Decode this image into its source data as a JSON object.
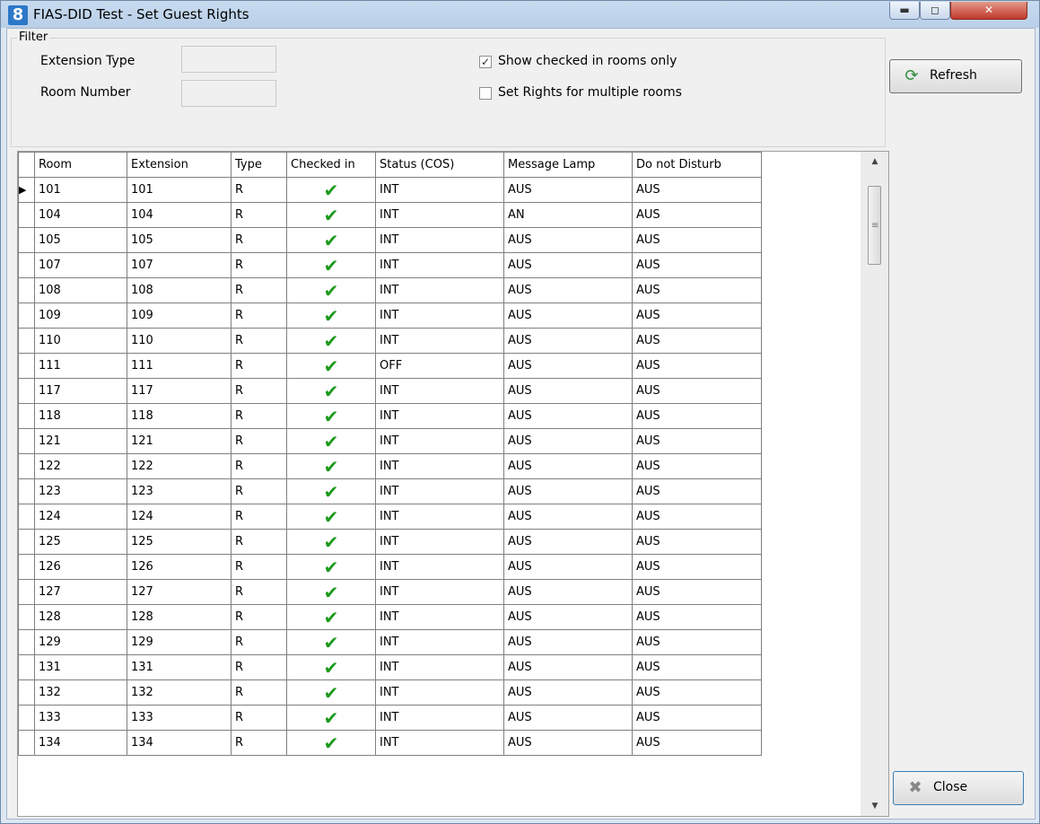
{
  "window": {
    "icon_text": "8",
    "title": "FIAS-DID Test -  Set Guest Rights",
    "min_symbol": "▬",
    "max_symbol": "◻",
    "close_symbol": "✕"
  },
  "filter": {
    "legend": "Filter",
    "extension_type_label": "Extension Type",
    "room_number_label": "Room Number",
    "extension_type_value": "",
    "room_number_value": "",
    "show_checked_in_label": "Show checked in rooms only",
    "show_checked_in_checked": true,
    "multiple_rooms_label": "Set Rights for multiple rooms",
    "multiple_rooms_checked": false
  },
  "buttons": {
    "refresh_label": "Refresh",
    "refresh_icon": "refresh-icon",
    "close_label": "Close",
    "close_icon": "close-x-icon"
  },
  "grid": {
    "columns": [
      "Room",
      "Extension",
      "Type",
      "Checked in",
      "Status (COS)",
      "Message Lamp",
      "Do not Disturb"
    ],
    "current_row_indicator": "▶",
    "checkmark": "✔",
    "rows": [
      {
        "room": "101",
        "extension": "101",
        "type": "R",
        "checked_in": true,
        "status": "INT",
        "lamp": "AUS",
        "dnd": "AUS"
      },
      {
        "room": "104",
        "extension": "104",
        "type": "R",
        "checked_in": true,
        "status": "INT",
        "lamp": "AN",
        "dnd": "AUS"
      },
      {
        "room": "105",
        "extension": "105",
        "type": "R",
        "checked_in": true,
        "status": "INT",
        "lamp": "AUS",
        "dnd": "AUS"
      },
      {
        "room": "107",
        "extension": "107",
        "type": "R",
        "checked_in": true,
        "status": "INT",
        "lamp": "AUS",
        "dnd": "AUS"
      },
      {
        "room": "108",
        "extension": "108",
        "type": "R",
        "checked_in": true,
        "status": "INT",
        "lamp": "AUS",
        "dnd": "AUS"
      },
      {
        "room": "109",
        "extension": "109",
        "type": "R",
        "checked_in": true,
        "status": "INT",
        "lamp": "AUS",
        "dnd": "AUS"
      },
      {
        "room": "110",
        "extension": "110",
        "type": "R",
        "checked_in": true,
        "status": "INT",
        "lamp": "AUS",
        "dnd": "AUS"
      },
      {
        "room": "111",
        "extension": "111",
        "type": "R",
        "checked_in": true,
        "status": "OFF",
        "lamp": "AUS",
        "dnd": "AUS"
      },
      {
        "room": "117",
        "extension": "117",
        "type": "R",
        "checked_in": true,
        "status": "INT",
        "lamp": "AUS",
        "dnd": "AUS"
      },
      {
        "room": "118",
        "extension": "118",
        "type": "R",
        "checked_in": true,
        "status": "INT",
        "lamp": "AUS",
        "dnd": "AUS"
      },
      {
        "room": "121",
        "extension": "121",
        "type": "R",
        "checked_in": true,
        "status": "INT",
        "lamp": "AUS",
        "dnd": "AUS"
      },
      {
        "room": "122",
        "extension": "122",
        "type": "R",
        "checked_in": true,
        "status": "INT",
        "lamp": "AUS",
        "dnd": "AUS"
      },
      {
        "room": "123",
        "extension": "123",
        "type": "R",
        "checked_in": true,
        "status": "INT",
        "lamp": "AUS",
        "dnd": "AUS"
      },
      {
        "room": "124",
        "extension": "124",
        "type": "R",
        "checked_in": true,
        "status": "INT",
        "lamp": "AUS",
        "dnd": "AUS"
      },
      {
        "room": "125",
        "extension": "125",
        "type": "R",
        "checked_in": true,
        "status": "INT",
        "lamp": "AUS",
        "dnd": "AUS"
      },
      {
        "room": "126",
        "extension": "126",
        "type": "R",
        "checked_in": true,
        "status": "INT",
        "lamp": "AUS",
        "dnd": "AUS"
      },
      {
        "room": "127",
        "extension": "127",
        "type": "R",
        "checked_in": true,
        "status": "INT",
        "lamp": "AUS",
        "dnd": "AUS"
      },
      {
        "room": "128",
        "extension": "128",
        "type": "R",
        "checked_in": true,
        "status": "INT",
        "lamp": "AUS",
        "dnd": "AUS"
      },
      {
        "room": "129",
        "extension": "129",
        "type": "R",
        "checked_in": true,
        "status": "INT",
        "lamp": "AUS",
        "dnd": "AUS"
      },
      {
        "room": "131",
        "extension": "131",
        "type": "R",
        "checked_in": true,
        "status": "INT",
        "lamp": "AUS",
        "dnd": "AUS"
      },
      {
        "room": "132",
        "extension": "132",
        "type": "R",
        "checked_in": true,
        "status": "INT",
        "lamp": "AUS",
        "dnd": "AUS"
      },
      {
        "room": "133",
        "extension": "133",
        "type": "R",
        "checked_in": true,
        "status": "INT",
        "lamp": "AUS",
        "dnd": "AUS"
      },
      {
        "room": "134",
        "extension": "134",
        "type": "R",
        "checked_in": true,
        "status": "INT",
        "lamp": "AUS",
        "dnd": "AUS"
      }
    ]
  },
  "scrollbar": {
    "up_symbol": "▲",
    "down_symbol": "▼",
    "grip_symbol": "≡"
  }
}
